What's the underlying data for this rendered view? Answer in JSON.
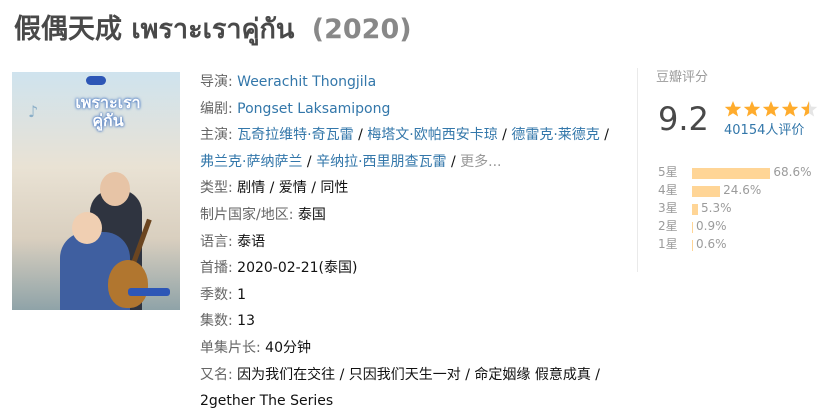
{
  "header": {
    "title_cn": "假偶天成",
    "title_th": "เพราะเราคู่กัน",
    "year": "(2020)"
  },
  "poster": {
    "image_alt": "drama-poster",
    "poster_title_line1": "เพราะเรา",
    "poster_title_line2": "คู่กัน"
  },
  "info": {
    "director_label": "导演",
    "director": "Weerachit Thongjila",
    "writer_label": "编剧",
    "writer": "Pongset Laksamipong",
    "cast_label": "主演",
    "cast": [
      "瓦奇拉维特·奇瓦雷",
      "梅塔文·欧帕西安卡琼",
      "德雷克·莱德克",
      "弗兰克·萨纳萨兰",
      "辛纳拉·西里朋查瓦雷"
    ],
    "cast_more": "更多...",
    "genre_label": "类型",
    "genres": [
      "剧情",
      "爱情",
      "同性"
    ],
    "country_label": "制片国家/地区",
    "country": "泰国",
    "language_label": "语言",
    "language": "泰语",
    "premiere_label": "首播",
    "premiere": "2020-02-21(泰国)",
    "seasons_label": "季数",
    "seasons": "1",
    "episodes_label": "集数",
    "episodes": "13",
    "runtime_label": "单集片长",
    "runtime": "40分钟",
    "aka_label": "又名",
    "aka": "因为我们在交往 / 只因我们天生一对 / 命定姻缘 假意成真 / 2gether The Series"
  },
  "rating": {
    "header": "豆瓣评分",
    "score": "9.2",
    "stars_value": 4.5,
    "count": "40154人评价",
    "star_color": "#ffac2d",
    "bar_color": "#ffd596",
    "breakdown": [
      {
        "label": "5星",
        "pct": "68.6%",
        "value": 68.6
      },
      {
        "label": "4星",
        "pct": "24.6%",
        "value": 24.6
      },
      {
        "label": "3星",
        "pct": "5.3%",
        "value": 5.3
      },
      {
        "label": "2星",
        "pct": "0.9%",
        "value": 0.9
      },
      {
        "label": "1星",
        "pct": "0.6%",
        "value": 0.6
      }
    ]
  }
}
